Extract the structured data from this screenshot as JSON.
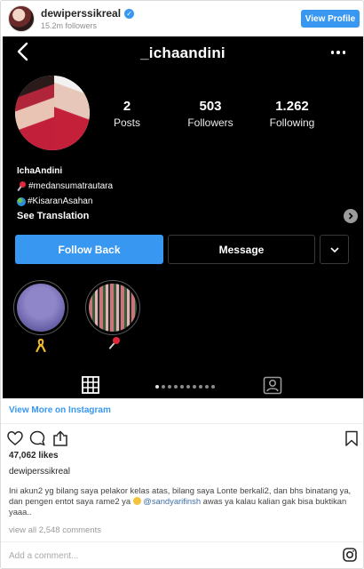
{
  "header": {
    "username": "dewiperssikreal",
    "followers_text": "15.2m followers",
    "view_profile_label": "View Profile",
    "verified_mark": "✓"
  },
  "screenshot": {
    "handle": "_ichaandini",
    "stats": [
      {
        "value": "2",
        "label": "Posts"
      },
      {
        "value": "503",
        "label": "Followers"
      },
      {
        "value": "1.262",
        "label": "Following"
      }
    ],
    "bio_name": "IchaAndini",
    "bio_lines": [
      "#medansumatrautara",
      "#KisaranAsahan"
    ],
    "see_translation": "See Translation",
    "follow_back_label": "Follow Back",
    "message_label": "Message",
    "page_indicator": {
      "total": 10,
      "active": 1
    }
  },
  "embed": {
    "view_more": "View More on Instagram",
    "likes": "47,062 likes",
    "owner": "dewiperssikreal",
    "caption_text": "Ini akun2 yg bilang saya pelakor kelas atas, bilang saya Lonte berkali2, dan bhs binatang ya, dan pengen entot saya rame2 ya",
    "caption_mention": "@sandyarifinsh",
    "caption_tail": "awas ya kalau kalian gak bisa buktikan yaaa..",
    "view_all_comments": "view all 2,548 comments",
    "add_comment_placeholder": "Add a comment..."
  },
  "colors": {
    "accent": "#3897f0",
    "screen_bg": "#000000",
    "muted_text": "#8e8e8e"
  },
  "icons": [
    "verified-icon",
    "back-arrow-icon",
    "more-options-icon",
    "chevron-right-icon",
    "chevron-down-icon",
    "pushpin-icon",
    "globe-icon",
    "ribbon-icon",
    "grid-icon",
    "tagged-icon",
    "heart-icon",
    "comment-icon",
    "share-icon",
    "bookmark-icon",
    "instagram-icon"
  ]
}
